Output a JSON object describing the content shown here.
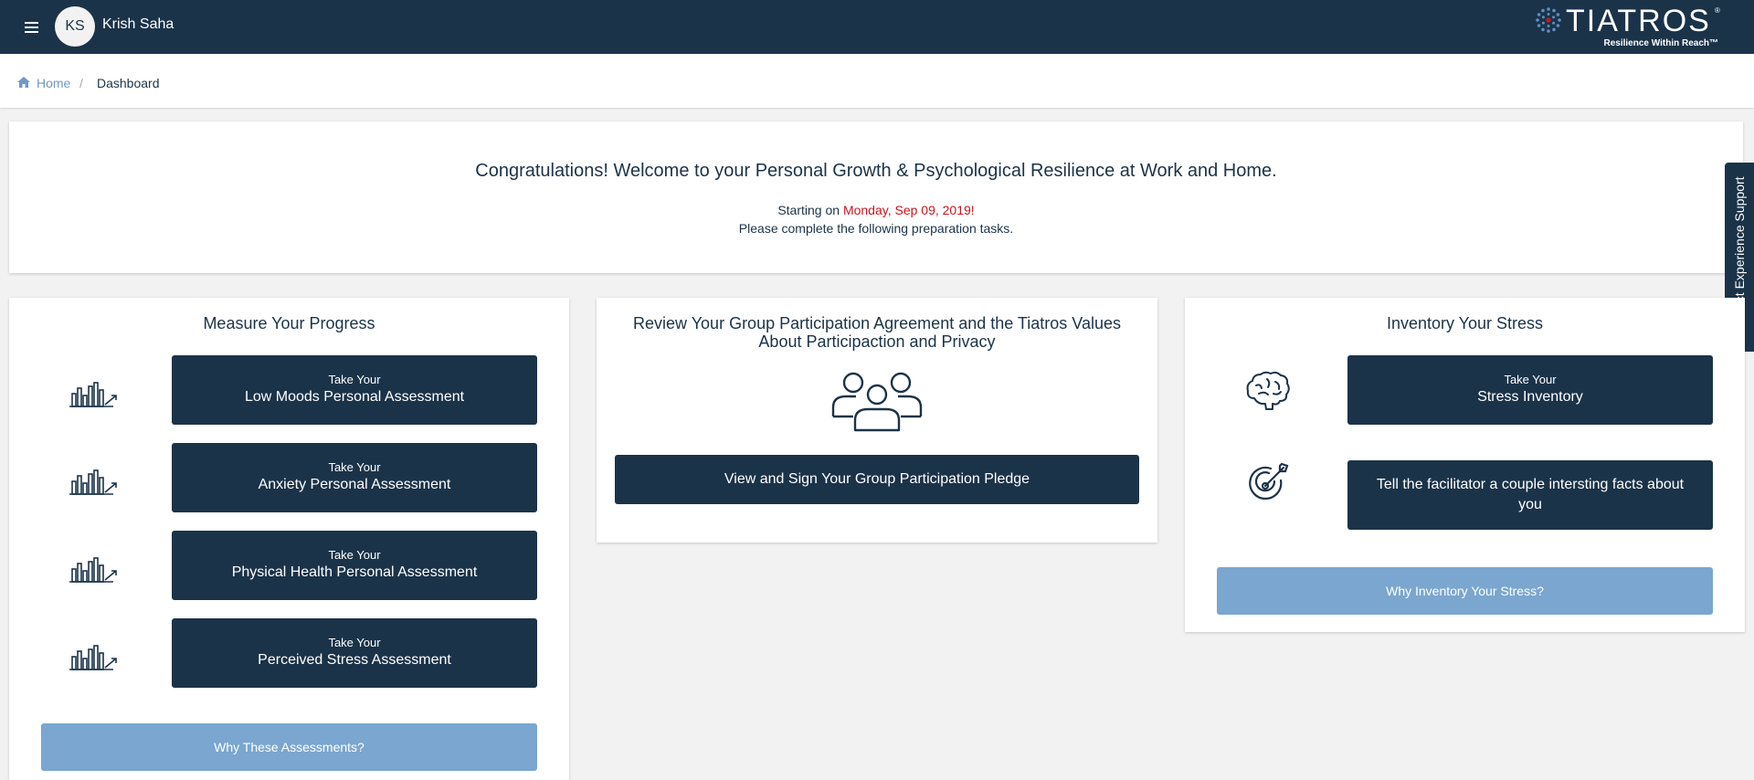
{
  "header": {
    "user_initials": "KS",
    "user_name": "Krish Saha",
    "logo_text": "TIATROS",
    "logo_tagline": "Resilience Within Reach™"
  },
  "breadcrumb": {
    "home": "Home",
    "separator": "/",
    "current": "Dashboard"
  },
  "welcome": {
    "title": "Congratulations! Welcome to your Personal Growth & Psychological Resilience at Work and Home.",
    "start_prefix": "Starting on ",
    "start_date": "Monday, Sep 09, 2019!",
    "subtitle": "Please complete the following preparation tasks."
  },
  "support_tab": "Product Experience Support",
  "progress": {
    "title": "Measure Your Progress",
    "items": [
      {
        "icon": "bar-chart-icon",
        "pre": "Take Your",
        "label": "Low Moods Personal Assessment"
      },
      {
        "icon": "bar-chart-icon",
        "pre": "Take Your",
        "label": "Anxiety Personal Assessment"
      },
      {
        "icon": "bar-chart-icon",
        "pre": "Take Your",
        "label": "Physical Health Personal Assessment"
      },
      {
        "icon": "bar-chart-icon",
        "pre": "Take Your",
        "label": "Perceived Stress Assessment"
      }
    ],
    "why_label": "Why These Assessments?"
  },
  "agreement": {
    "title_line1": "Review Your Group Participation Agreement and the Tiatros Values",
    "title_line2": "About Participaction and Privacy",
    "icon": "group-icon",
    "button_label": "View and Sign Your Group Participation Pledge"
  },
  "stress": {
    "title": "Inventory Your Stress",
    "inventory_pre": "Take Your",
    "inventory_label": "Stress Inventory",
    "facts_label": "Tell the facilitator a couple intersting facts about you",
    "why_label": "Why Inventory Your Stress?"
  },
  "colors": {
    "navy": "#1b3349",
    "light_blue": "#7aa6cf",
    "accent_red": "#d0121b",
    "link_blue": "#6f98c2"
  }
}
